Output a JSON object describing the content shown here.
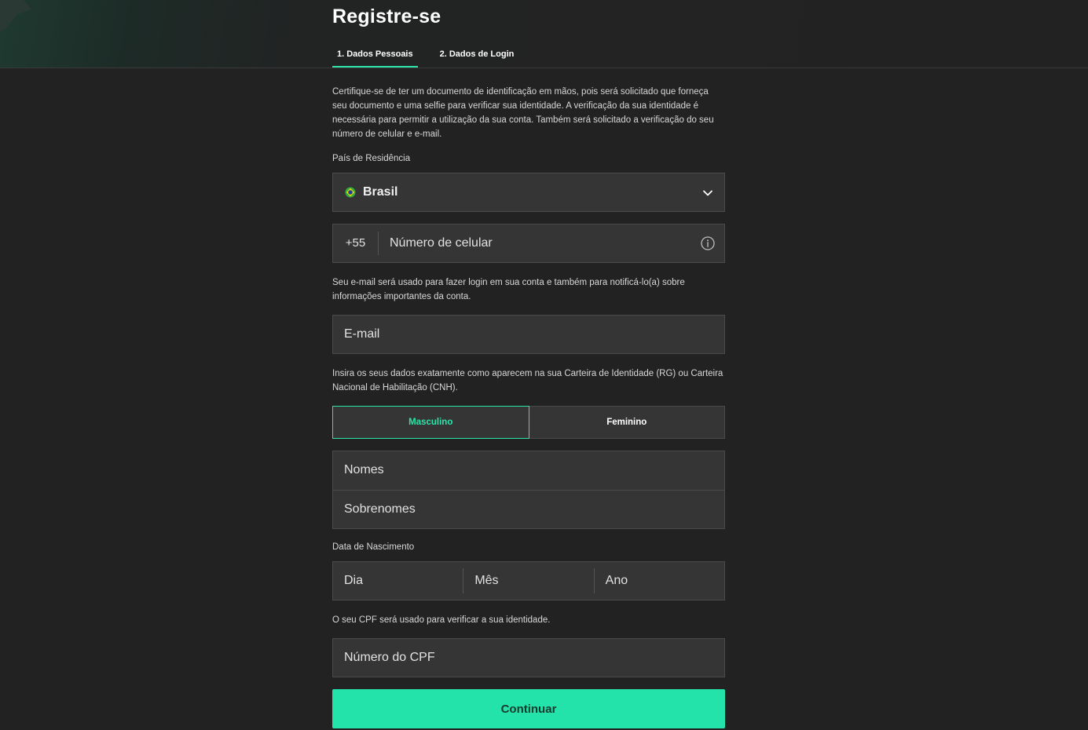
{
  "header": {
    "title": "Registre-se",
    "tabs": [
      {
        "label": "1. Dados Pessoais",
        "active": true
      },
      {
        "label": "2. Dados de Login",
        "active": false
      }
    ]
  },
  "intro_text": "Certifique-se de ter um documento de identificação em mãos, pois será solicitado que forneça seu documento e uma selfie para verificar sua identidade. A verificação da sua identidade é necessária para permitir a utilização da sua conta. Também será solicitado a verificação do seu número de celular e e-mail.",
  "country": {
    "label": "País de Residência",
    "value": "Brasil",
    "flag_icon": "brazil-flag-icon",
    "dropdown_icon": "chevron-down-icon"
  },
  "phone": {
    "prefix": "+55",
    "placeholder": "Número de celular",
    "info_icon": "info-icon"
  },
  "email": {
    "help": "Seu e-mail será usado para fazer login em sua conta e também para notificá-lo(a) sobre informações importantes da conta.",
    "placeholder": "E-mail"
  },
  "identity_help": "Insira os seus dados exatamente como aparecem na sua Carteira de Identidade (RG) ou Carteira Nacional de Habilitação (CNH).",
  "gender": {
    "options": [
      "Masculino",
      "Feminino"
    ],
    "selected": "Masculino"
  },
  "names": {
    "first_placeholder": "Nomes",
    "last_placeholder": "Sobrenomes"
  },
  "birthdate": {
    "label": "Data de Nascimento",
    "day_placeholder": "Dia",
    "month_placeholder": "Mês",
    "year_placeholder": "Ano"
  },
  "cpf": {
    "help": "O seu CPF será usado para verificar a sua identidade.",
    "placeholder": "Número do CPF"
  },
  "submit": {
    "label": "Continuar"
  },
  "colors": {
    "accent": "#2ae6ab",
    "button_bg": "#24e3aa",
    "background": "#222222",
    "field_bg": "#353535"
  }
}
